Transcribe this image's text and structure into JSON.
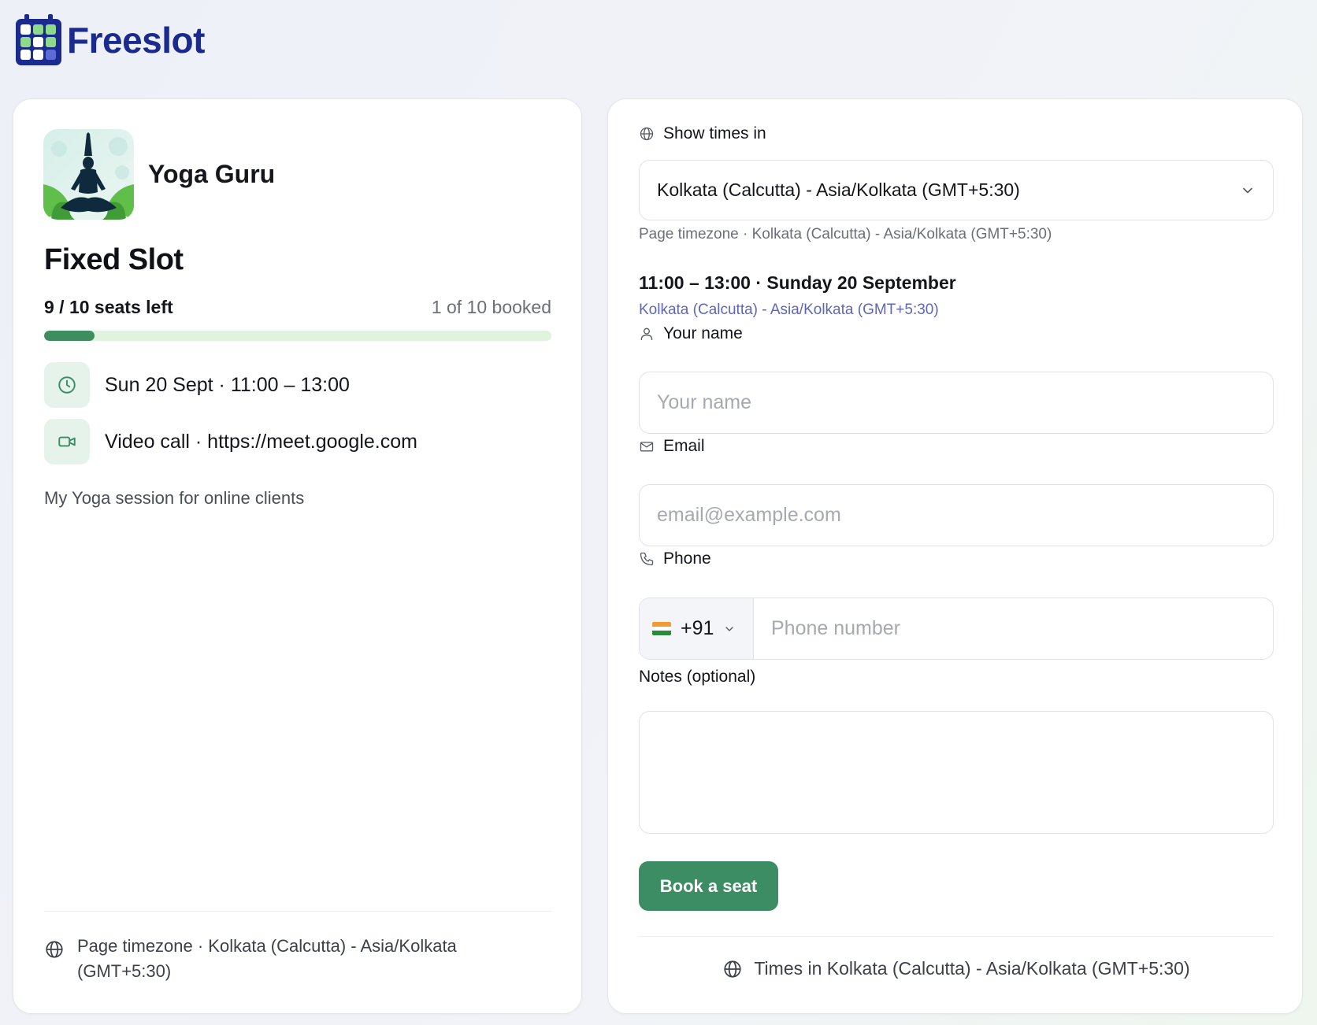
{
  "brand": {
    "name": "Freeslot",
    "color": "#1b2a8f"
  },
  "host": {
    "name": "Yoga Guru",
    "avatar_icon": "yoga-pose-icon"
  },
  "event": {
    "title": "Fixed Slot",
    "seats_left": "9 / 10 seats left",
    "booked": "1 of 10 booked",
    "booked_fraction": 0.1,
    "datetime": "Sun 20 Sept · 11:00 – 13:00",
    "location": "Video call · https://meet.google.com",
    "description": "My Yoga session for online clients",
    "footer_timezone": "Page timezone · Kolkata (Calcutta) - Asia/Kolkata (GMT+5:30)"
  },
  "booking": {
    "show_times_label": "Show times in",
    "timezone_selected": "Kolkata (Calcutta) - Asia/Kolkata (GMT+5:30)",
    "page_timezone_hint": "Page timezone · Kolkata (Calcutta) - Asia/Kolkata (GMT+5:30)",
    "slot_title": "11:00 – 13:00 · Sunday 20 September",
    "slot_timezone": "Kolkata (Calcutta) - Asia/Kolkata (GMT+5:30)",
    "name_label": "Your name",
    "name_placeholder": "Your name",
    "email_label": "Email",
    "email_placeholder": "email@example.com",
    "phone_label": "Phone",
    "phone_code": "+91",
    "phone_placeholder": "Phone number",
    "notes_label": "Notes (optional)",
    "submit_label": "Book a seat",
    "footer_text": "Times in Kolkata (Calcutta) - Asia/Kolkata (GMT+5:30)"
  },
  "colors": {
    "accent": "#3d8d64",
    "progress_track": "#dff3df",
    "icon_bg": "#e6f3ea",
    "link": "#5f67b5"
  }
}
